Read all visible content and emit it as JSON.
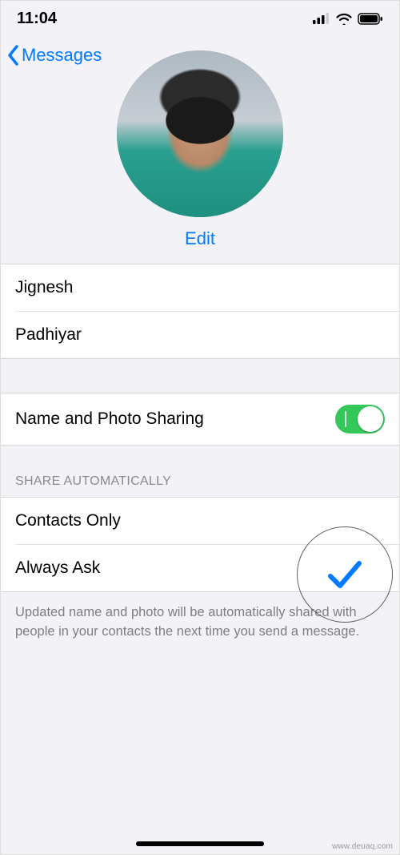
{
  "status": {
    "time": "11:04"
  },
  "nav": {
    "back_label": "Messages"
  },
  "profile": {
    "edit_label": "Edit"
  },
  "name_fields": {
    "first": "Jignesh",
    "last": "Padhiyar"
  },
  "sharing": {
    "toggle_label": "Name and Photo Sharing",
    "toggle_on": true
  },
  "share_auto": {
    "header": "SHARE AUTOMATICALLY",
    "options": [
      {
        "label": "Contacts Only",
        "selected": true
      },
      {
        "label": "Always Ask",
        "selected": false
      }
    ],
    "footer": "Updated name and photo will be automatically shared with people in your contacts the next time you send a message."
  },
  "watermark": "www.deuaq.com"
}
